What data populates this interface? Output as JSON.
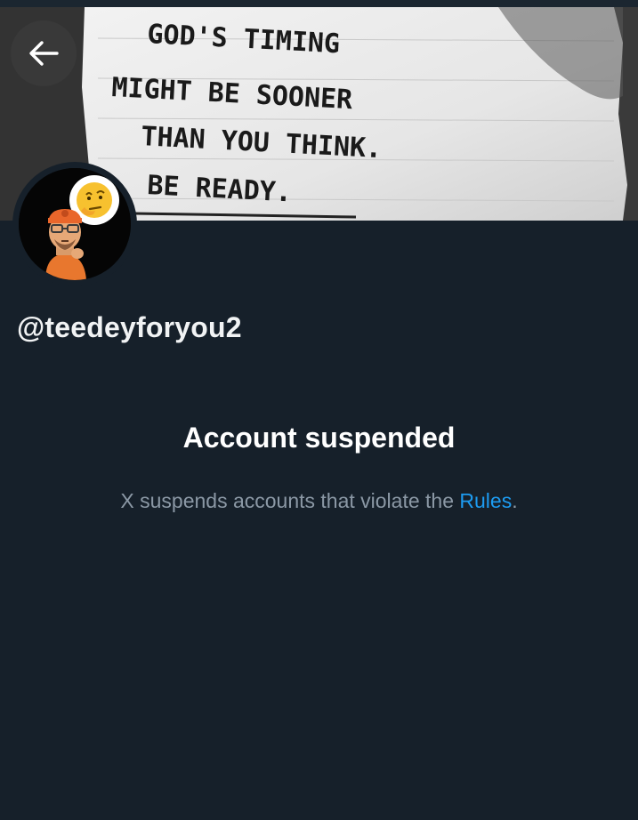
{
  "banner": {
    "note_lines": [
      "GOD'S TIMING",
      "MIGHT BE SOONER",
      "THAN YOU THINK.",
      "BE READY."
    ]
  },
  "nav": {
    "back_icon": "arrow-left-icon"
  },
  "profile": {
    "handle": "@teedeyforyou2",
    "avatar_icon": "thinking-emoji-avatar"
  },
  "suspension": {
    "title": "Account suspended",
    "description_prefix": "X suspends accounts that violate the ",
    "rules_link": "Rules",
    "description_suffix": "."
  },
  "colors": {
    "background": "#16202a",
    "link": "#1d9bf0",
    "muted_text": "#8b98a5",
    "heading_text": "#ffffff"
  }
}
